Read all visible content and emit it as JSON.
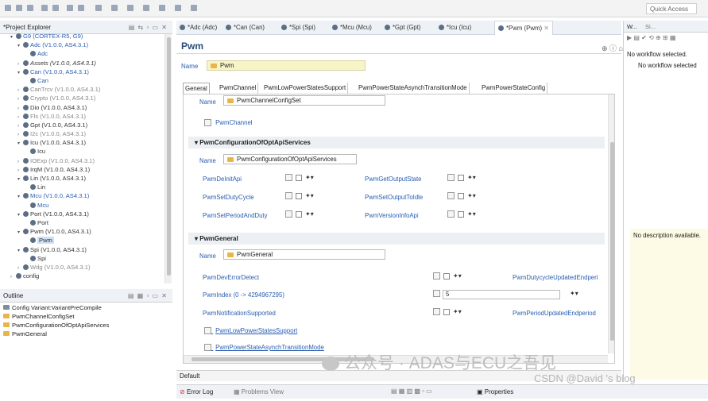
{
  "toolbar": {
    "quick_access": "Quick Access"
  },
  "project_explorer": {
    "title": "*Project Explorer",
    "items": [
      {
        "label": "G9 (CORTEX-R5, G9)",
        "style": "blue",
        "indent": 1,
        "arrow": "open"
      },
      {
        "label": "Adc (V1.0.0, AS4.3.1)",
        "style": "blue",
        "indent": 2,
        "arrow": "open"
      },
      {
        "label": "Adc",
        "style": "blue",
        "indent": 3,
        "arrow": ""
      },
      {
        "label": "Assets (V1.0.0, AS4.3.1)",
        "style": "italic",
        "indent": 2,
        "arrow": "closed"
      },
      {
        "label": "Can (V1.0.0, AS4.3.1)",
        "style": "blue",
        "indent": 2,
        "arrow": "open"
      },
      {
        "label": "Can",
        "style": "blue",
        "indent": 3,
        "arrow": ""
      },
      {
        "label": "CanTrcv (V1.0.0, AS4.3.1)",
        "style": "grey",
        "indent": 2,
        "arrow": "closed"
      },
      {
        "label": "Crypto (V1.0.0, AS4.3.1)",
        "style": "grey",
        "indent": 2,
        "arrow": "closed"
      },
      {
        "label": "Dio (V1.0.0, AS4.3.1)",
        "style": "",
        "indent": 2,
        "arrow": "closed"
      },
      {
        "label": "Fls (V1.0.0, AS4.3.1)",
        "style": "grey",
        "indent": 2,
        "arrow": "closed"
      },
      {
        "label": "Gpt (V1.0.0, AS4.3.1)",
        "style": "",
        "indent": 2,
        "arrow": "closed"
      },
      {
        "label": "I2c (V1.0.0, AS4.3.1)",
        "style": "grey",
        "indent": 2,
        "arrow": "closed"
      },
      {
        "label": "Icu (V1.0.0, AS4.3.1)",
        "style": "",
        "indent": 2,
        "arrow": "open"
      },
      {
        "label": "Icu",
        "style": "",
        "indent": 3,
        "arrow": ""
      },
      {
        "label": "IOExp (V1.0.0, AS4.3.1)",
        "style": "grey",
        "indent": 2,
        "arrow": "closed"
      },
      {
        "label": "IrqM (V1.0.0, AS4.3.1)",
        "style": "",
        "indent": 2,
        "arrow": "closed"
      },
      {
        "label": "Lin (V1.0.0, AS4.3.1)",
        "style": "",
        "indent": 2,
        "arrow": "open"
      },
      {
        "label": "Lin",
        "style": "",
        "indent": 3,
        "arrow": ""
      },
      {
        "label": "Mcu (V1.0.0, AS4.3.1)",
        "style": "blue",
        "indent": 2,
        "arrow": "open"
      },
      {
        "label": "Mcu",
        "style": "blue",
        "indent": 3,
        "arrow": ""
      },
      {
        "label": "Port (V1.0.0, AS4.3.1)",
        "style": "",
        "indent": 2,
        "arrow": "open"
      },
      {
        "label": "Port",
        "style": "",
        "indent": 3,
        "arrow": ""
      },
      {
        "label": "Pwm (V1.0.0, AS4.3.1)",
        "style": "",
        "indent": 2,
        "arrow": "open"
      },
      {
        "label": "Pwm",
        "style": "selected",
        "indent": 3,
        "arrow": ""
      },
      {
        "label": "Spi (V1.0.0, AS4.3.1)",
        "style": "",
        "indent": 2,
        "arrow": "open"
      },
      {
        "label": "Spi",
        "style": "",
        "indent": 3,
        "arrow": ""
      },
      {
        "label": "Wdg (V1.0.0, AS4.3.1)",
        "style": "grey",
        "indent": 2,
        "arrow": "closed"
      },
      {
        "label": "config",
        "style": "",
        "indent": 1,
        "arrow": "closed"
      }
    ]
  },
  "outline": {
    "title": "Outline",
    "items": [
      {
        "label": "Config Variant:VariantPreCompile",
        "kind": "cfg"
      },
      {
        "label": "PwmChannelConfigSet",
        "kind": "folder"
      },
      {
        "label": "PwmConfigurationOfOptApiServices",
        "kind": "folder"
      },
      {
        "label": "PwmGeneral",
        "kind": "folder"
      }
    ]
  },
  "editor_tabs": [
    {
      "label": "*Adc (Adc)",
      "active": false
    },
    {
      "label": "*Can (Can)",
      "active": false
    },
    {
      "label": "*Spi (Spi)",
      "active": false
    },
    {
      "label": "*Mcu (Mcu)",
      "active": false
    },
    {
      "label": "*Gpt (Gpt)",
      "active": false
    },
    {
      "label": "*Icu (Icu)",
      "active": false
    },
    {
      "label": "*Pwm (Pwm)",
      "active": true
    }
  ],
  "editor": {
    "title": "Pwm",
    "name_label": "Name",
    "name_value": "Pwm",
    "param_tabs": [
      "General",
      "PwmChannel",
      "PwmLowPowerStatesSupport",
      "PwmPowerStateAsynchTransitionMode",
      "PwmPowerStateConfig"
    ],
    "channel_config": {
      "name_label": "Name",
      "name_value": "PwmChannelConfigSet",
      "link": "PwmChannel"
    },
    "opt_api": {
      "header": "PwmConfigurationOfOptApiServices",
      "name_label": "Name",
      "name_value": "PwmConfigurationOfOptApiServices",
      "params": [
        "PwmDeInitApi",
        "PwmGetOutputState",
        "PwmSetDutyCycle",
        "PwmSetOutputToIdle",
        "PwmSetPeriodAndDuty",
        "PwmVersionInfoApi"
      ]
    },
    "general": {
      "header": "PwmGeneral",
      "name_label": "Name",
      "name_value": "PwmGeneral",
      "dev_error_detect": "PwmDevErrorDetect",
      "dev_error_right": "PwmDutycycleUpdatedEndperi",
      "index_label": "PwmIndex (0 -> 4294967295)",
      "index_value": "5",
      "notification": "PwmNotificationSupported",
      "notification_right": "PwmPeriodUpdatedEndperiod",
      "link_low_power": "PwmLowPowerStatesSupport",
      "link_async": "PwmPowerStateAsynchTransitionMode"
    },
    "bottom_tab": "Default"
  },
  "bottom_views": {
    "error_log": "Error Log",
    "problems": "Problems View",
    "properties": "Properties"
  },
  "right_pane": {
    "title": "W...",
    "tab2": "Si...",
    "no_workflow": "No workflow selected.",
    "no_workflow_cut": "No workflow selected",
    "no_description": "No description available."
  },
  "watermark": {
    "line1": "公众号 · ADAS与ECU之吾见",
    "line2": "CSDN @David 's blog"
  }
}
